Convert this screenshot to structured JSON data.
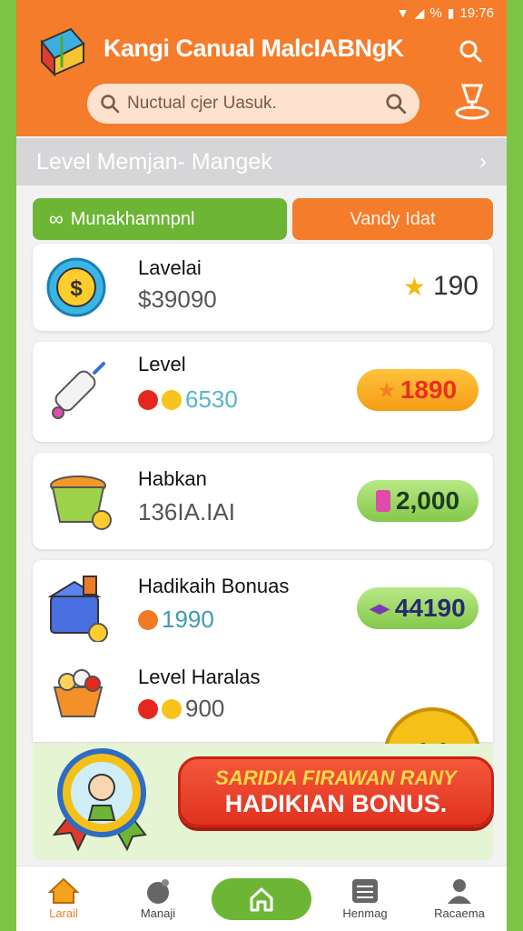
{
  "status_bar": {
    "time": "19:76",
    "battery": "%"
  },
  "header": {
    "title": "Kangi Canual MalcIABNgK",
    "search_placeholder": "Nuctual cjer Uasuk."
  },
  "level_strip": {
    "label": "Level Memjan- Mangek"
  },
  "tabs": [
    {
      "label": "Munakhamnpnl"
    },
    {
      "label": "Vandy Idat"
    }
  ],
  "items": [
    {
      "title": "Lavelai",
      "sub": "$39090",
      "price": "190"
    },
    {
      "title": "Level",
      "sub": "6530",
      "price": "1890"
    },
    {
      "title": "Habkan",
      "sub": "136IA.IAI",
      "price": "2,000"
    },
    {
      "title": "Hadikaih Bonuas",
      "sub": "1990",
      "price": "44190"
    },
    {
      "title": "Level Haralas",
      "sub": "900"
    }
  ],
  "banner": {
    "line1": "SARIDIA FIRAWAN RANY",
    "line2": "HADIKIAN BONUS."
  },
  "bottom_nav": [
    {
      "label": "Larail",
      "icon": "home-icon"
    },
    {
      "label": "Manaji",
      "icon": "game-icon"
    },
    {
      "label": "",
      "icon": "home-icon"
    },
    {
      "label": "Henmag",
      "icon": "list-icon"
    },
    {
      "label": "Racaema",
      "icon": "profile-icon"
    }
  ],
  "colors": {
    "brand_orange": "#f47c2b",
    "brand_green": "#6db635",
    "background": "#7cc443"
  }
}
